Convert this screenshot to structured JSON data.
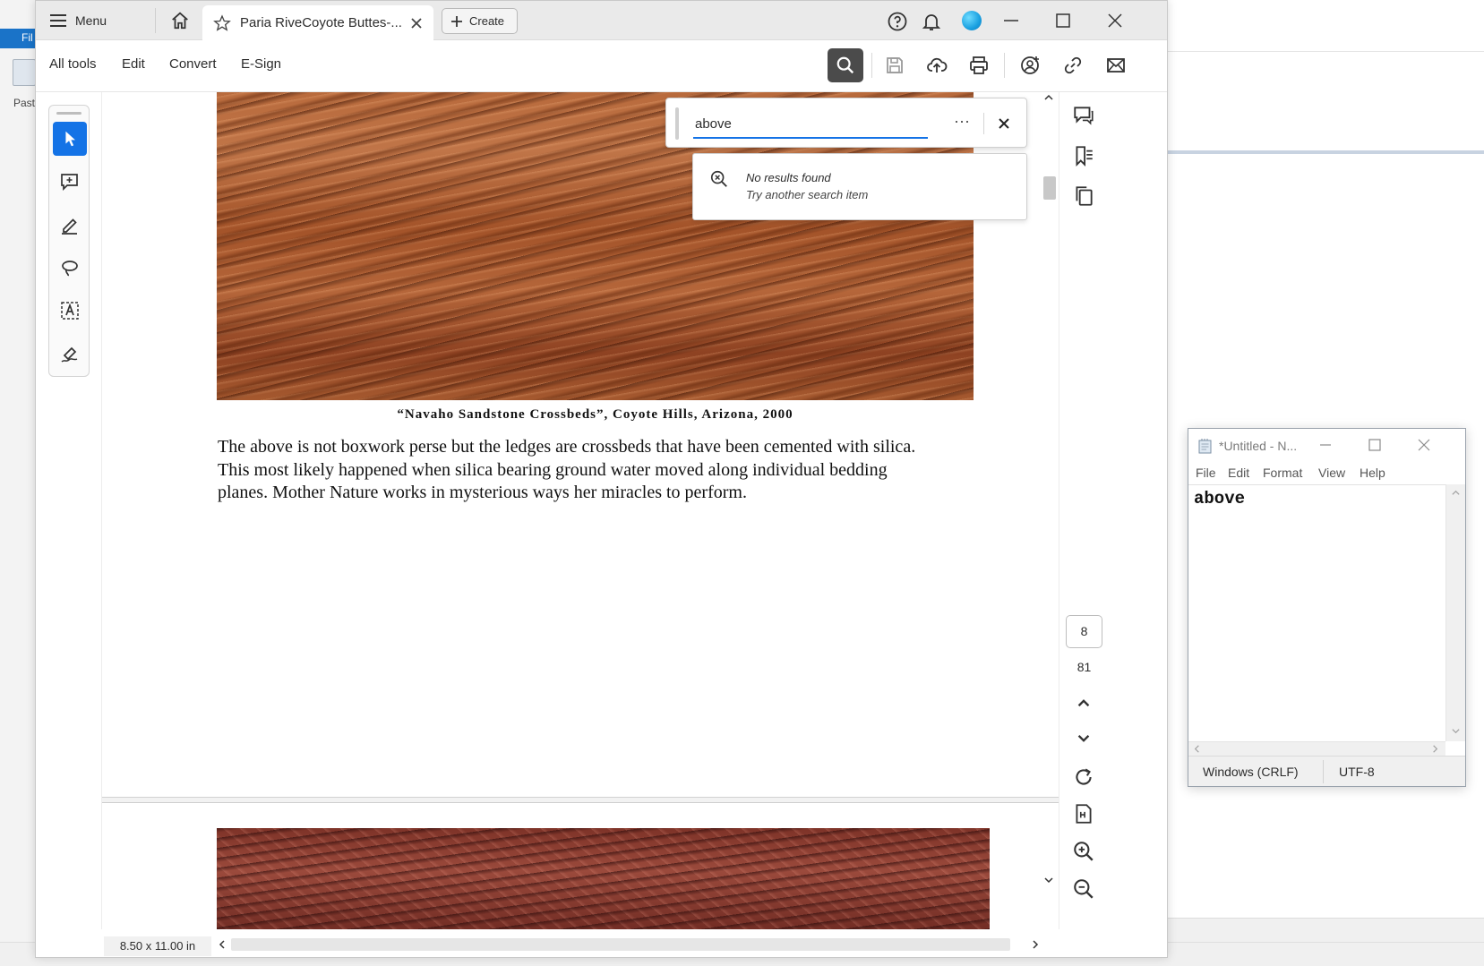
{
  "background_app": {
    "file_tab": "Fil",
    "paste_label": "Past"
  },
  "acrobat": {
    "titlebar": {
      "menu_label": "Menu",
      "tab_title": "Paria RiveCoyote Buttes-...",
      "create_label": "Create"
    },
    "toolbar": {
      "items": [
        "All tools",
        "Edit",
        "Convert",
        "E-Sign"
      ]
    },
    "find": {
      "query": "above",
      "more_label": "···",
      "result_line1": "No results found",
      "result_line2": "Try another search item"
    },
    "document": {
      "caption": "“Navaho Sandstone Crossbeds”, Coyote Hills, Arizona, 2000",
      "paragraph": [
        "The above is not boxwork perse but the ledges are crossbeds that have been cemented with silica.",
        "This most likely happened when silica bearing ground water moved along individual bedding",
        "planes.  Mother Nature works in mysterious ways her miracles to perform."
      ]
    },
    "navigation": {
      "current_page": "8",
      "total_pages": "81"
    },
    "status": {
      "page_size": "8.50 x 11.00 in"
    },
    "colors": {
      "accent": "#1473e6",
      "search_button": "#4b4b4b"
    }
  },
  "notepad": {
    "title": "*Untitled - N...",
    "menu": [
      "File",
      "Edit",
      "Format",
      "View",
      "Help"
    ],
    "content": "above",
    "line_ending": "Windows (CRLF)",
    "encoding": "UTF-8"
  }
}
